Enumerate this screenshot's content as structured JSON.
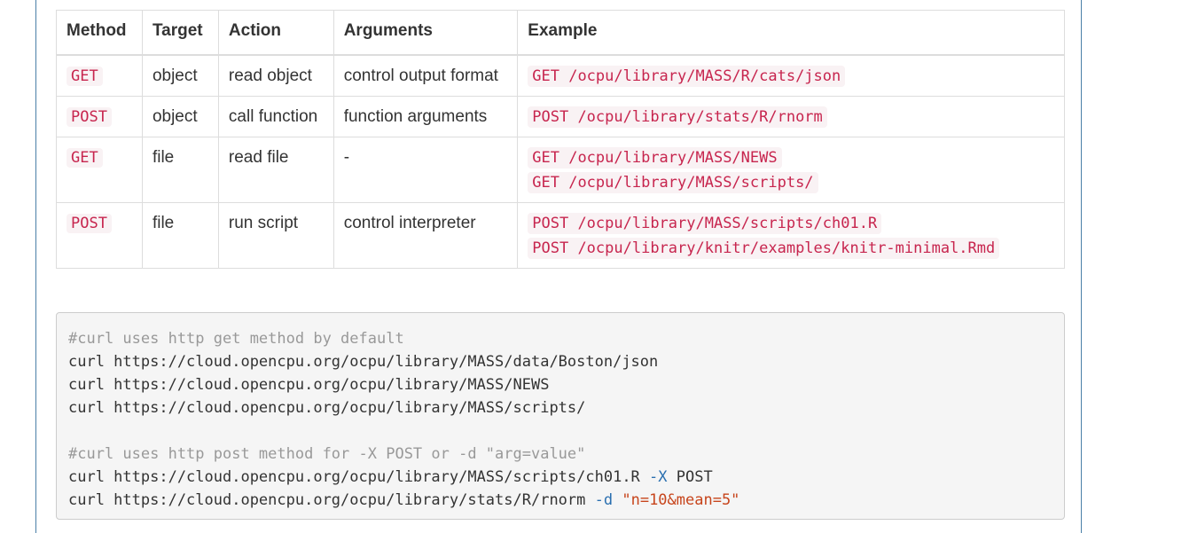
{
  "table": {
    "headers": [
      "Method",
      "Target",
      "Action",
      "Arguments",
      "Example"
    ],
    "rows": [
      {
        "method": "GET",
        "target": "object",
        "action": "read object",
        "arguments": "control output format",
        "examples": [
          "GET /ocpu/library/MASS/R/cats/json"
        ]
      },
      {
        "method": "POST",
        "target": "object",
        "action": "call function",
        "arguments": "function arguments",
        "examples": [
          "POST /ocpu/library/stats/R/rnorm"
        ]
      },
      {
        "method": "GET",
        "target": "file",
        "action": "read file",
        "arguments": "-",
        "examples": [
          "GET /ocpu/library/MASS/NEWS",
          "GET /ocpu/library/MASS/scripts/"
        ]
      },
      {
        "method": "POST",
        "target": "file",
        "action": "run script",
        "arguments": "control interpreter",
        "examples": [
          "POST /ocpu/library/MASS/scripts/ch01.R",
          "POST /ocpu/library/knitr/examples/knitr-minimal.Rmd"
        ]
      }
    ]
  },
  "code_block": {
    "comment_get": "#curl uses http get method by default",
    "get_lines": [
      "curl https://cloud.opencpu.org/ocpu/library/MASS/data/Boston/json",
      "curl https://cloud.opencpu.org/ocpu/library/MASS/NEWS",
      "curl https://cloud.opencpu.org/ocpu/library/MASS/scripts/"
    ],
    "comment_post": "#curl uses http post method for -X POST or -d \"arg=value\"",
    "post_line_1": {
      "cmd": "curl https://cloud.opencpu.org/ocpu/library/MASS/scripts/ch01.R ",
      "flag": "-X",
      "rest": " POST"
    },
    "post_line_2": {
      "cmd": "curl https://cloud.opencpu.org/ocpu/library/stats/R/rnorm ",
      "flag": "-d",
      "space": " ",
      "string": "\"n=10&mean=5\""
    }
  },
  "colors": {
    "inline_code_text": "#c7254e",
    "inline_code_bg": "#f9f2f4",
    "panel_border": "#4a7fa8",
    "code_flag": "#2a6fb0",
    "code_string": "#c7451c"
  }
}
